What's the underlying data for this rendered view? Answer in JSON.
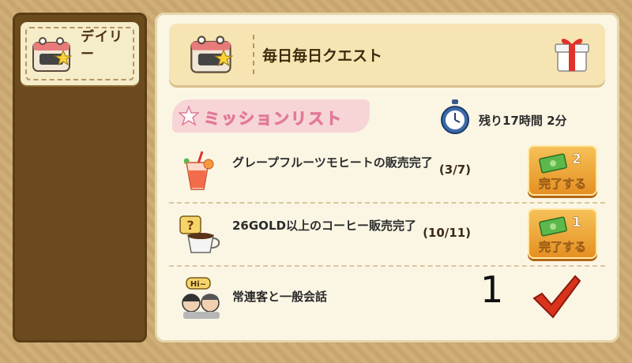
{
  "sidebar": {
    "tab_label": "デイリー",
    "tab_icon": "daily-calendar-icon"
  },
  "header": {
    "title": "毎日毎日クエスト",
    "icon": "daily-calendar-icon",
    "gift_icon": "gift-box-icon"
  },
  "missions": {
    "section_title": "ミッションリスト",
    "remaining_time": "残り17時間 2分",
    "items": [
      {
        "name": "グレープフルーツモヒートの販売完了",
        "progress": "(3/7)",
        "reward": "2",
        "button_label": "完了する",
        "icon": "drink-glass-icon"
      },
      {
        "name": "26GOLD以上のコーヒー販売完了",
        "progress": "(10/11)",
        "reward": "1",
        "button_label": "完了する",
        "icon": "coffee-cup-icon"
      },
      {
        "name": "常連客と一般会話",
        "status": "completed",
        "icon": "customers-chat-icon"
      }
    ]
  },
  "overlay_number": "1",
  "colors": {
    "accent_orange": "#e58e20",
    "check_red": "#d9331d",
    "banner_pink": "#f7d5d7"
  }
}
